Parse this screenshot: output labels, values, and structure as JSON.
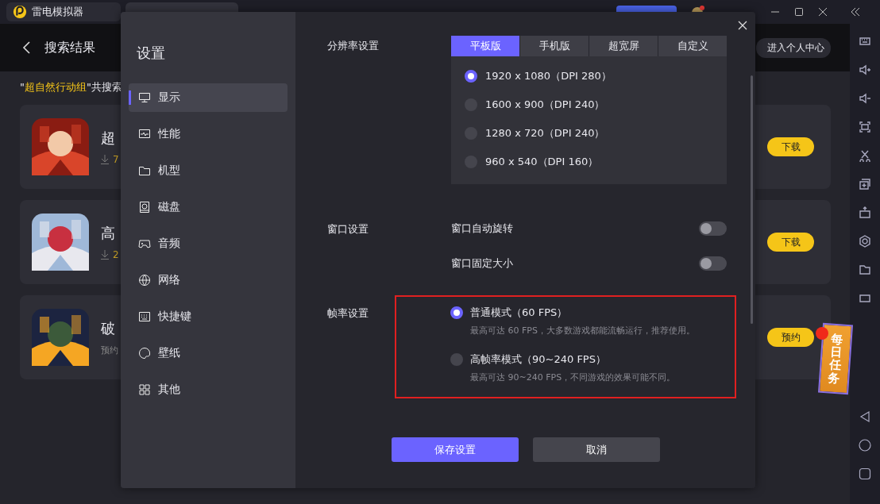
{
  "app_tabs": [
    {
      "label": "雷电模拟器"
    }
  ],
  "header": {
    "title": "搜索结果",
    "profile_button": "进入个人中心"
  },
  "search_summary": {
    "prefix": "\"",
    "keyword": "超自然行动组",
    "suffix": "\"共搜索"
  },
  "results": [
    {
      "title": "超",
      "kind": "downloads",
      "meta": "7",
      "action": "下载"
    },
    {
      "title": "高",
      "kind": "downloads",
      "meta": "2",
      "action": "下载"
    },
    {
      "title": "破",
      "kind": "status",
      "meta": "预约",
      "action": "预约"
    }
  ],
  "daily_task": {
    "label": "每日任务",
    "notification": true
  },
  "settings": {
    "title": "设置",
    "nav": [
      {
        "label": "显示",
        "selected": true
      },
      {
        "label": "性能",
        "selected": false
      },
      {
        "label": "机型",
        "selected": false
      },
      {
        "label": "磁盘",
        "selected": false
      },
      {
        "label": "音频",
        "selected": false
      },
      {
        "label": "网络",
        "selected": false
      },
      {
        "label": "快捷键",
        "selected": false
      },
      {
        "label": "壁纸",
        "selected": false
      },
      {
        "label": "其他",
        "selected": false
      }
    ],
    "resolution": {
      "label": "分辨率设置",
      "tabs": [
        {
          "label": "平板版",
          "selected": true
        },
        {
          "label": "手机版",
          "selected": false
        },
        {
          "label": "超宽屏",
          "selected": false
        },
        {
          "label": "自定义",
          "selected": false
        }
      ],
      "options": [
        {
          "label": "1920 x 1080（DPI 280）",
          "selected": true
        },
        {
          "label": "1600 x 900（DPI 240）",
          "selected": false
        },
        {
          "label": "1280 x 720（DPI 240）",
          "selected": false
        },
        {
          "label": "960 x 540（DPI 160）",
          "selected": false
        }
      ]
    },
    "window": {
      "label": "窗口设置",
      "toggles": [
        {
          "label": "窗口自动旋转",
          "on": false
        },
        {
          "label": "窗口固定大小",
          "on": false
        }
      ]
    },
    "framerate": {
      "label": "帧率设置",
      "highlighted": true,
      "options": [
        {
          "label": "普通模式（60 FPS）",
          "description": "最高可达 60 FPS，大多数游戏都能流畅运行，推荐使用。",
          "selected": true
        },
        {
          "label": "高帧率模式（90~240 FPS）",
          "description": "最高可达 90~240 FPS，不同游戏的效果可能不同。",
          "selected": false
        }
      ]
    },
    "buttons": [
      {
        "label": "保存设置",
        "kind": "primary"
      },
      {
        "label": "取消",
        "kind": "secondary"
      }
    ]
  }
}
